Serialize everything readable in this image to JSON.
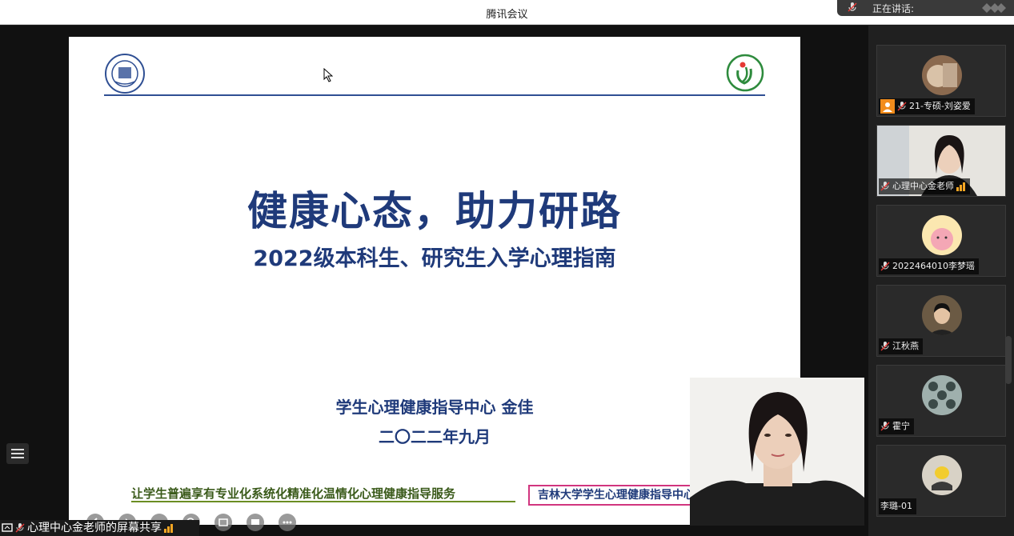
{
  "window": {
    "title": "腾讯会议"
  },
  "speaking_bar": {
    "label": "正在讲话:"
  },
  "slide": {
    "title": "健康心态，助力研路",
    "subtitle": "2022级本科生、研究生入学心理指南",
    "presenter": "学生心理健康指导中心  金佳",
    "date": "二〇二二年九月",
    "slogan": "让学生普遍享有专业化系统化精准化温情化心理健康指导服务",
    "center_name": "吉林大学学生心理健康指导中心",
    "logo_left_text": "JILIN UNIVERSITY · CHINA"
  },
  "participants": [
    {
      "name": "21-专硕-刘姿爱",
      "badge": "orange-user-icon"
    },
    {
      "name": "心理中心金老师",
      "badge": ""
    },
    {
      "name": "2022464010李梦瑶",
      "badge": ""
    },
    {
      "name": "江秋燕",
      "badge": ""
    },
    {
      "name": "霍宁",
      "badge": ""
    },
    {
      "name": "李璐-01",
      "badge": ""
    }
  ],
  "share_bar": {
    "label": "心理中心金老师的屏幕共享"
  },
  "colors": {
    "slide_text": "#1f3a7a",
    "accent_pink": "#d1357f",
    "orange": "#f28c1c"
  }
}
